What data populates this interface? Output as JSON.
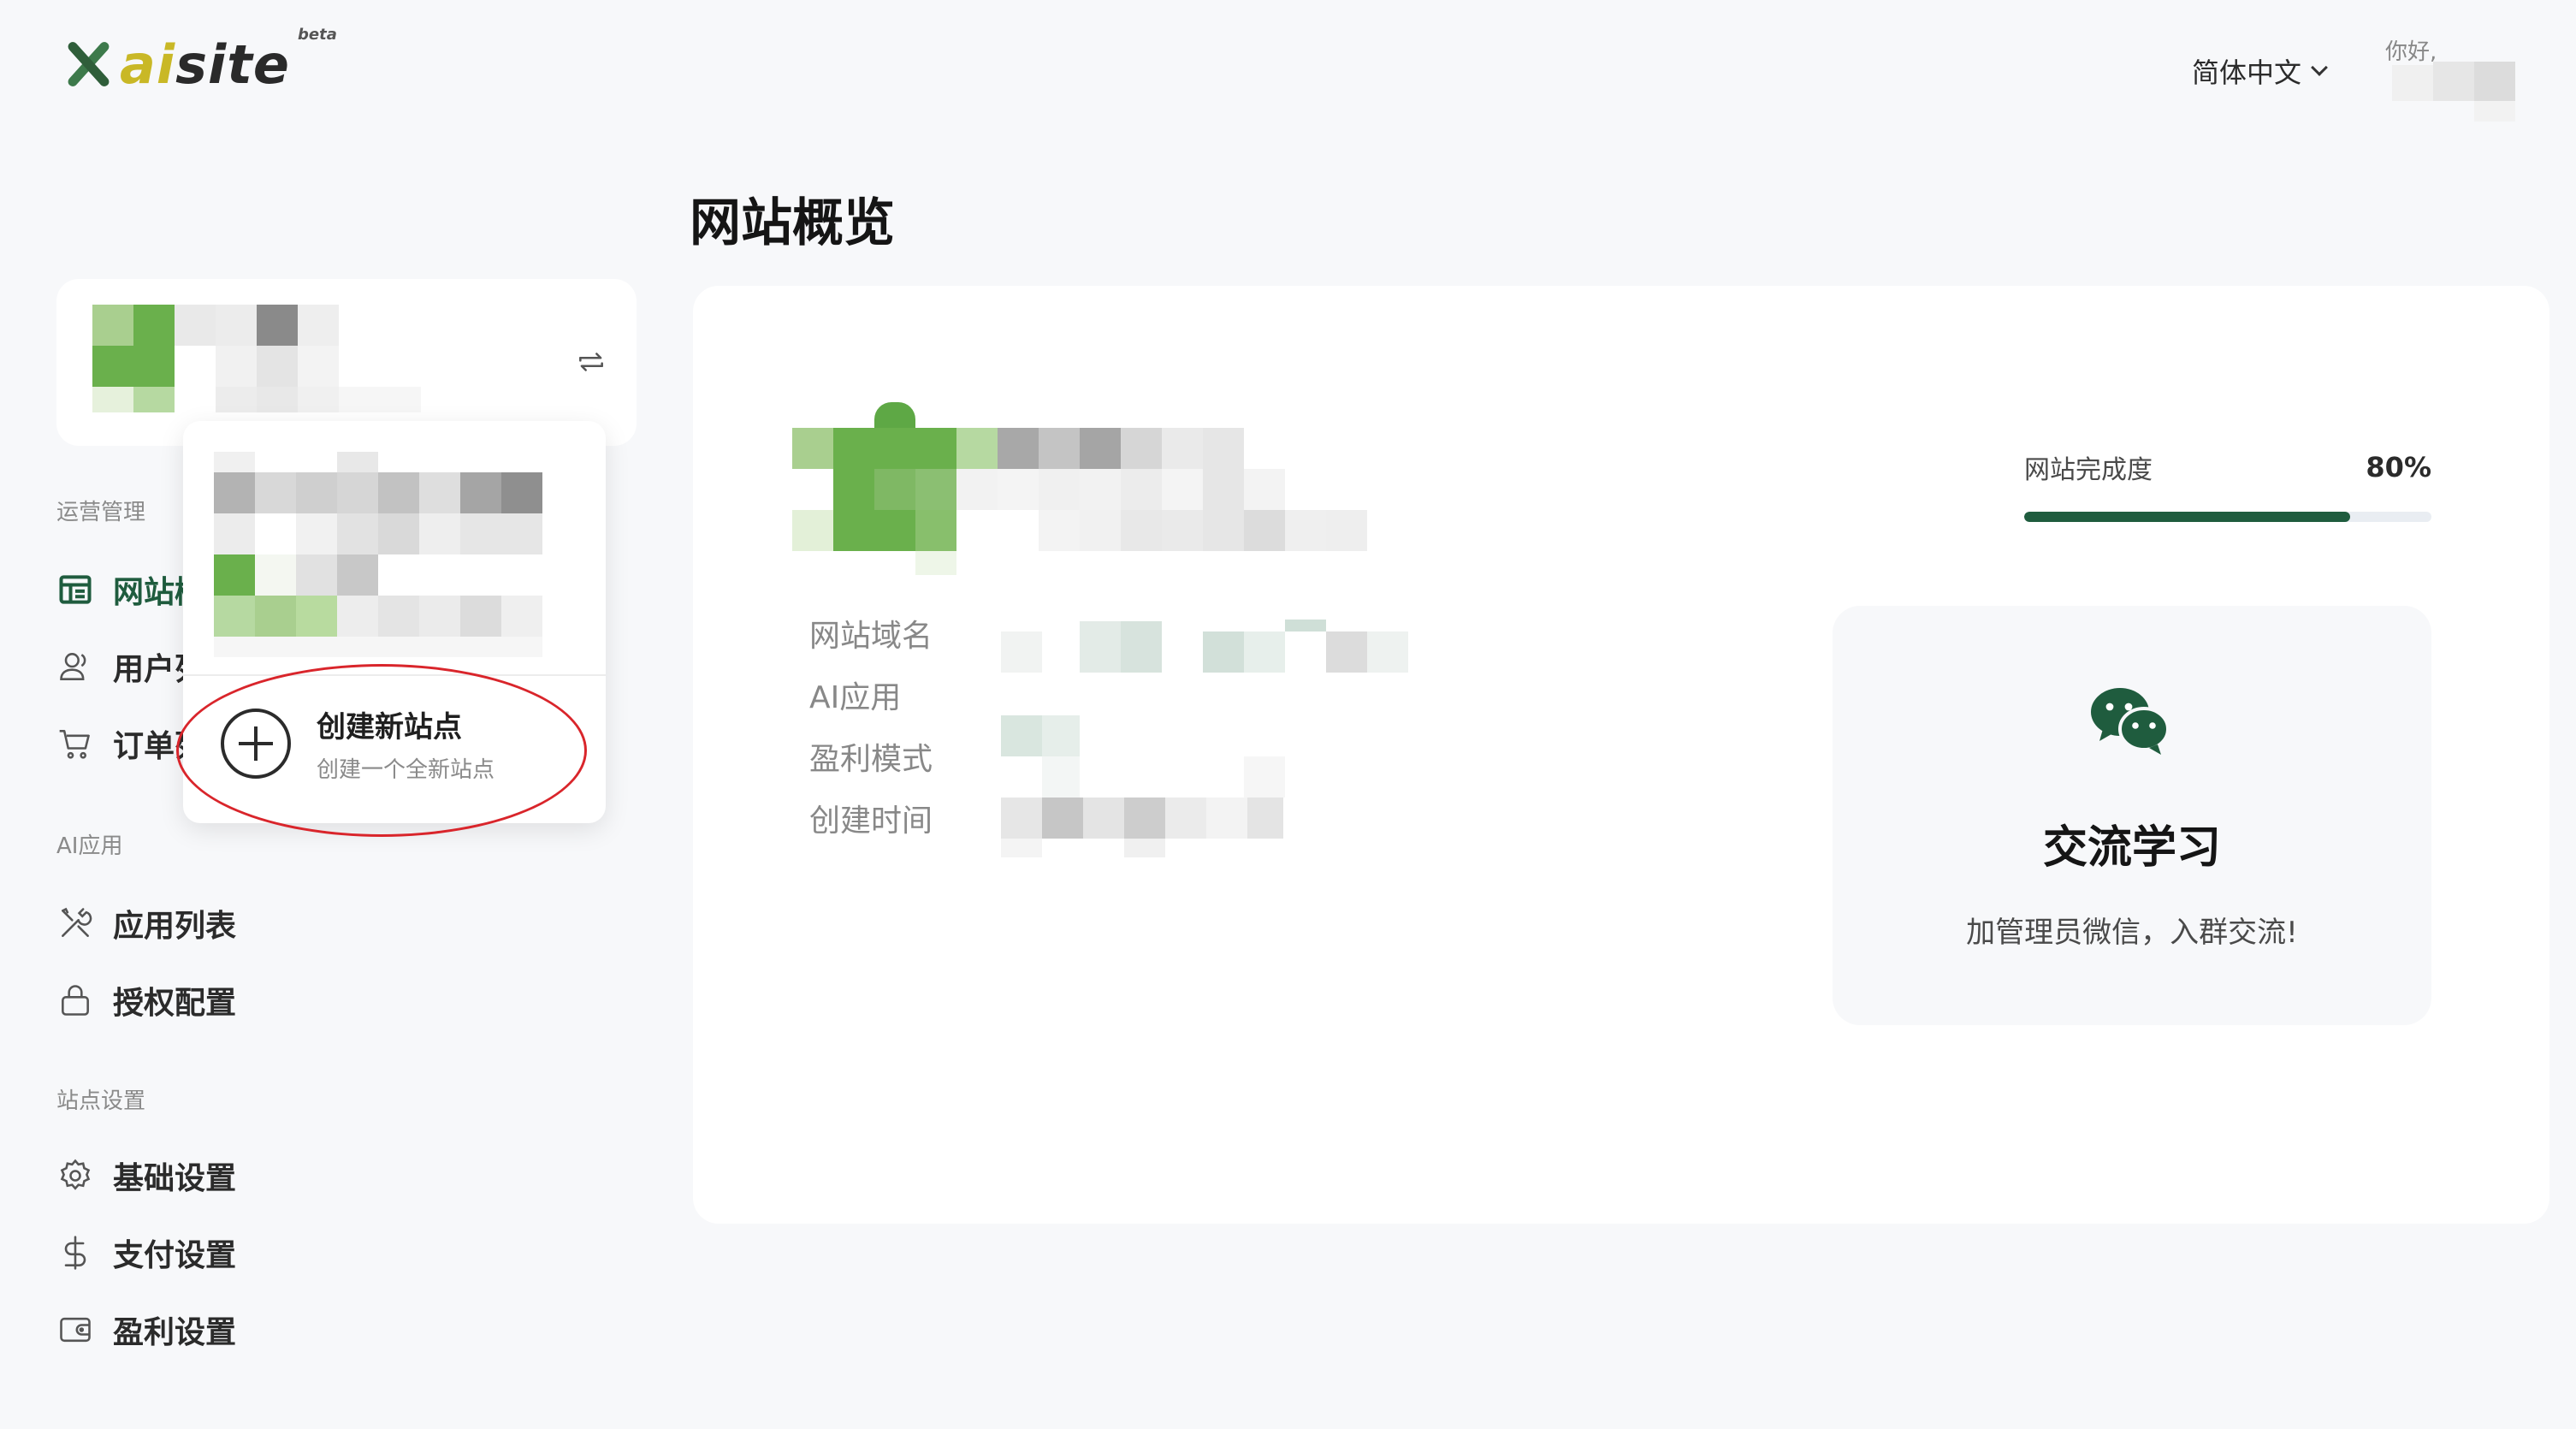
{
  "header": {
    "logo": {
      "prefix": "ai",
      "suffix": "site",
      "badge": "beta"
    },
    "language": "简体中文",
    "greeting": "你好,"
  },
  "sidebar": {
    "sections": [
      {
        "label": "运营管理"
      },
      {
        "label": "AI应用"
      },
      {
        "label": "站点设置"
      }
    ],
    "items": [
      {
        "label": "网站概览",
        "icon": "dashboard-icon",
        "active": true
      },
      {
        "label": "用户列表",
        "icon": "user-icon"
      },
      {
        "label": "订单列表",
        "icon": "cart-icon"
      },
      {
        "label": "应用列表",
        "icon": "tools-icon"
      },
      {
        "label": "授权配置",
        "icon": "lock-icon"
      },
      {
        "label": "基础设置",
        "icon": "gear-icon"
      },
      {
        "label": "支付设置",
        "icon": "dollar-icon"
      },
      {
        "label": "盈利设置",
        "icon": "wallet-icon"
      }
    ]
  },
  "dropdown": {
    "create_title": "创建新站点",
    "create_subtitle": "创建一个全新站点"
  },
  "main": {
    "title": "网站概览",
    "info_labels": [
      "网站域名",
      "AI应用",
      "盈利模式",
      "创建时间"
    ],
    "progress": {
      "label": "网站完成度",
      "value_text": "80%",
      "fraction": 0.8
    },
    "community": {
      "title": "交流学习",
      "description": "加管理员微信，入群交流!"
    }
  },
  "colors": {
    "accent": "#1f5c3e",
    "annotation": "#d9252b",
    "logo_yellow": "#c9b826"
  }
}
